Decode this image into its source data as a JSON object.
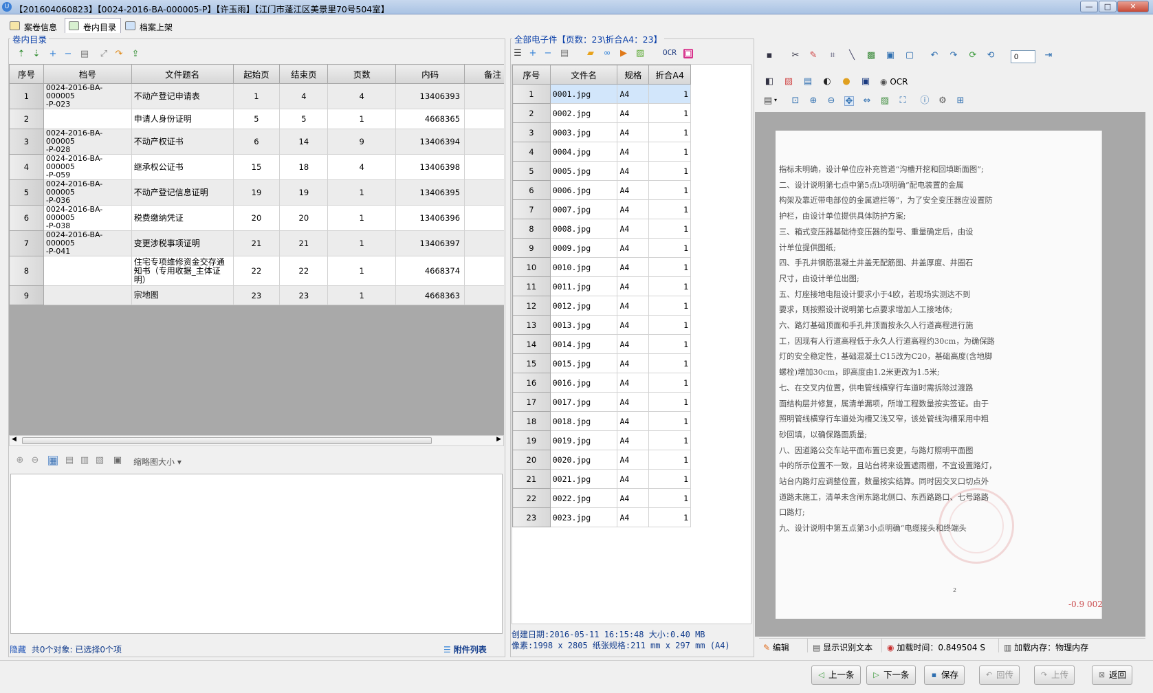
{
  "window": {
    "title": "【201604060823】【0024-2016-BA-000005-P】【许玉雨】【江门市蓬江区美景里70号504室】"
  },
  "tabs": [
    {
      "label": "案卷信息"
    },
    {
      "label": "卷内目录"
    },
    {
      "label": "档案上架"
    }
  ],
  "left_pane": {
    "title": "卷内目录",
    "columns": [
      "序号",
      "档号",
      "文件题名",
      "起始页",
      "结束页",
      "页数",
      "内码",
      "备注"
    ],
    "rows": [
      {
        "idx": "1",
        "code": "0024-2016-BA-000005\n-P-023",
        "name": "不动产登记申请表",
        "start": "1",
        "end": "4",
        "pages": "4",
        "inner": "13406393"
      },
      {
        "idx": "2",
        "code": "",
        "name": "申请人身份证明",
        "start": "5",
        "end": "5",
        "pages": "1",
        "inner": "4668365"
      },
      {
        "idx": "3",
        "code": "0024-2016-BA-000005\n-P-028",
        "name": "不动产权证书",
        "start": "6",
        "end": "14",
        "pages": "9",
        "inner": "13406394"
      },
      {
        "idx": "4",
        "code": "0024-2016-BA-000005\n-P-059",
        "name": "继承权公证书",
        "start": "15",
        "end": "18",
        "pages": "4",
        "inner": "13406398"
      },
      {
        "idx": "5",
        "code": "0024-2016-BA-000005\n-P-036",
        "name": "不动产登记信息证明",
        "start": "19",
        "end": "19",
        "pages": "1",
        "inner": "13406395"
      },
      {
        "idx": "6",
        "code": "0024-2016-BA-000005\n-P-038",
        "name": "税费缴纳凭证",
        "start": "20",
        "end": "20",
        "pages": "1",
        "inner": "13406396"
      },
      {
        "idx": "7",
        "code": "0024-2016-BA-000005\n-P-041",
        "name": "变更涉税事项证明",
        "start": "21",
        "end": "21",
        "pages": "1",
        "inner": "13406397"
      },
      {
        "idx": "8",
        "code": "",
        "name": "住宅专项维修资金交存通知书（专用收据_主体证明）",
        "start": "22",
        "end": "22",
        "pages": "1",
        "inner": "4668374"
      },
      {
        "idx": "9",
        "code": "",
        "name": "宗地图",
        "start": "23",
        "end": "23",
        "pages": "1",
        "inner": "4668363"
      }
    ],
    "thumb_toolbar": {
      "label": "缩略图大小"
    },
    "status": {
      "hide": "隐藏",
      "count": "共0个对象:  已选择0个项",
      "attach": "附件列表"
    }
  },
  "mid_pane": {
    "title": "全部电子件【页数：23\\折合A4：23】",
    "ocr_label": "OCR",
    "columns": [
      "序号",
      "文件名",
      "规格",
      "折合A4"
    ],
    "rows": [
      {
        "idx": "1",
        "file": "0001.jpg",
        "spec": "A4",
        "a4": "1"
      },
      {
        "idx": "2",
        "file": "0002.jpg",
        "spec": "A4",
        "a4": "1"
      },
      {
        "idx": "3",
        "file": "0003.jpg",
        "spec": "A4",
        "a4": "1"
      },
      {
        "idx": "4",
        "file": "0004.jpg",
        "spec": "A4",
        "a4": "1"
      },
      {
        "idx": "5",
        "file": "0005.jpg",
        "spec": "A4",
        "a4": "1"
      },
      {
        "idx": "6",
        "file": "0006.jpg",
        "spec": "A4",
        "a4": "1"
      },
      {
        "idx": "7",
        "file": "0007.jpg",
        "spec": "A4",
        "a4": "1"
      },
      {
        "idx": "8",
        "file": "0008.jpg",
        "spec": "A4",
        "a4": "1"
      },
      {
        "idx": "9",
        "file": "0009.jpg",
        "spec": "A4",
        "a4": "1"
      },
      {
        "idx": "10",
        "file": "0010.jpg",
        "spec": "A4",
        "a4": "1"
      },
      {
        "idx": "11",
        "file": "0011.jpg",
        "spec": "A4",
        "a4": "1"
      },
      {
        "idx": "12",
        "file": "0012.jpg",
        "spec": "A4",
        "a4": "1"
      },
      {
        "idx": "13",
        "file": "0013.jpg",
        "spec": "A4",
        "a4": "1"
      },
      {
        "idx": "14",
        "file": "0014.jpg",
        "spec": "A4",
        "a4": "1"
      },
      {
        "idx": "15",
        "file": "0015.jpg",
        "spec": "A4",
        "a4": "1"
      },
      {
        "idx": "16",
        "file": "0016.jpg",
        "spec": "A4",
        "a4": "1"
      },
      {
        "idx": "17",
        "file": "0017.jpg",
        "spec": "A4",
        "a4": "1"
      },
      {
        "idx": "18",
        "file": "0018.jpg",
        "spec": "A4",
        "a4": "1"
      },
      {
        "idx": "19",
        "file": "0019.jpg",
        "spec": "A4",
        "a4": "1"
      },
      {
        "idx": "20",
        "file": "0020.jpg",
        "spec": "A4",
        "a4": "1"
      },
      {
        "idx": "21",
        "file": "0021.jpg",
        "spec": "A4",
        "a4": "1"
      },
      {
        "idx": "22",
        "file": "0022.jpg",
        "spec": "A4",
        "a4": "1"
      },
      {
        "idx": "23",
        "file": "0023.jpg",
        "spec": "A4",
        "a4": "1"
      }
    ],
    "info_line1": "创建日期:2016-05-11  16:15:48  大小:0.40 MB",
    "info_line2": "像素:1998 x 2805 纸张规格:211 mm x 297 mm (A4)"
  },
  "viewer": {
    "page_input": "0",
    "ocr_label": "OCR",
    "doc_lines": [
      "指标未明确，设计单位应补充管道“沟槽开挖和回填断面图”;",
      "    二、设计说明第七点中第5点b项明确“配电装置的金属",
      "构架及靠近带电部位的金属遮拦等”，为了安全变压器应设置防",
      "护栏，由设计单位提供具体防护方案;",
      "    三、箱式变压器基础待变压器的型号、重量确定后，由设",
      "计单位提供图纸;",
      "    四、手孔井钢筋混凝土井盖无配筋图、井盖厚度、井圈石",
      "尺寸，由设计单位出图;",
      "    五、灯座接地电阻设计要求小于4欧，若现场实测达不到",
      "要求，则按照设计说明第七点要求增加人工接地体;",
      "    六、路灯基础顶面和手孔井顶面按永久人行道高程进行施",
      "工，因现有人行道高程低于永久人行道高程约30cm，为确保路",
      "灯的安全稳定性，基础混凝土C15改为C20，基础高度(含地脚",
      "螺栓)增加30cm，即高度由1.2米更改为1.5米;",
      "    七、在交叉内位置，供电管线横穿行车道时需拆除过渡路",
      "面结构层并修复，属清单漏项，所增工程数量按实签证。由于",
      "照明管线横穿行车道处沟槽又浅又窄，该处管线沟槽采用中粗",
      "砂回填，以确保路面质量;",
      "    八、因道路公交车站平面布置已变更，与路灯照明平面图",
      "中的所示位置不一致，且站台将来设置遮雨棚，不宜设置路灯，",
      "站台内路灯应调整位置，数量按实结算。同时因交叉口切点外",
      "道路未施工，清单未含闸东路北侧口、东西路路口、七号路路",
      "口路灯;",
      "    九、设计说明中第五点第3小点明确“电缆接头和终端头"
    ],
    "page_number": "2",
    "corner_mark": "-0.9   002",
    "status_edit": "编辑",
    "status_ocr": "显示识别文本",
    "status_time": "加载时间：0.849504 S",
    "status_mem": "加载内存：物理内存"
  },
  "bottom": {
    "prev": "上一条",
    "next": "下一条",
    "save": "保存",
    "rollback": "回传",
    "upload": "上传",
    "back": "返回"
  }
}
